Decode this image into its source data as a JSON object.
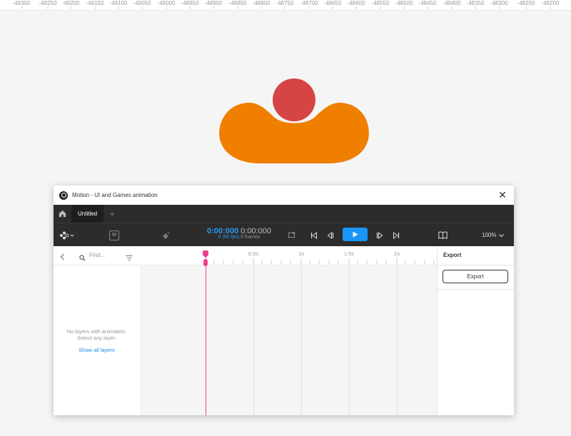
{
  "ruler": {
    "ticks": [
      "-49300",
      "-49250",
      "-49200",
      "-49150",
      "-49100",
      "-49050",
      "-49000",
      "-48950",
      "-48900",
      "-48850",
      "-48800",
      "-48750",
      "-48700",
      "-48650",
      "-48600",
      "-48550",
      "-48500",
      "-48450",
      "-48400",
      "-48350",
      "-48300",
      "-48250",
      "-48200"
    ]
  },
  "artwork": {
    "circle_color": "#D64545",
    "blob_color": "#F07F00"
  },
  "window": {
    "title": "Motion - UI and Games animation",
    "close_icon": "close-icon"
  },
  "tabs": {
    "home_icon": "home-icon",
    "active_tab": "Untitled",
    "add_icon": "plus-icon"
  },
  "toolbar": {
    "m_label": "M",
    "current_time": "0:00:000",
    "duration": "0:00:000",
    "fps_text": "0 (60 fps)",
    "frames_text": "0 frames",
    "zoom": "100%"
  },
  "left_panel": {
    "find_placeholder": "Find...",
    "empty_line1": "No layers with animation.",
    "empty_line2": "Select any layer.",
    "show_all": "Show all layers"
  },
  "timeline": {
    "labels": [
      "0.5s",
      "1s",
      "1.5s",
      "2s"
    ]
  },
  "right_panel": {
    "title": "Export",
    "export_button": "Export"
  },
  "colors": {
    "accent": "#1A95F5",
    "playhead": "#EE3F8F"
  }
}
